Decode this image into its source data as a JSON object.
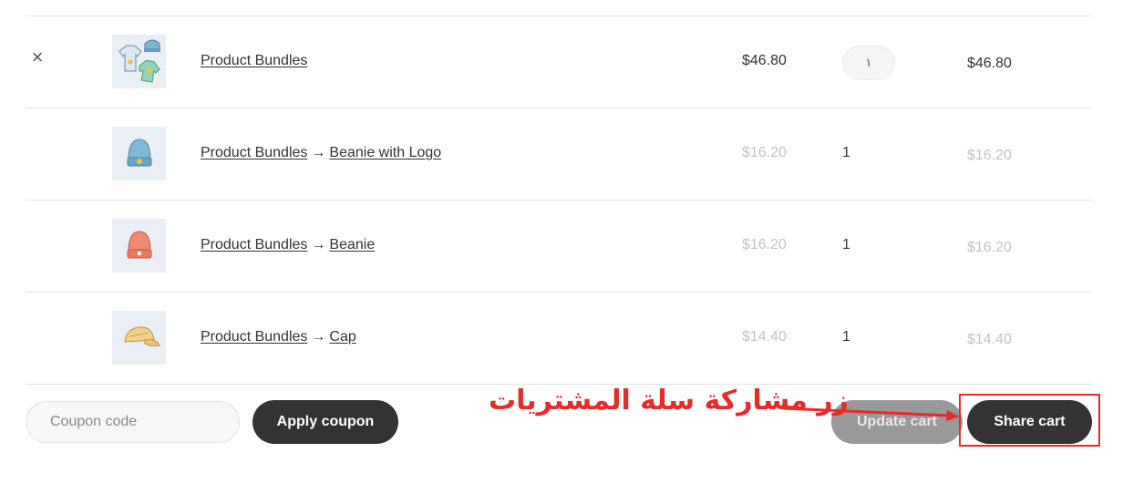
{
  "cart": {
    "items": [
      {
        "remove_icon": "×",
        "parent": "Product Bundles",
        "child": "",
        "price": "$46.80",
        "qty": "١",
        "subtotal": "$46.80",
        "thumb": "bundle-apparel-icon"
      },
      {
        "parent": "Product Bundles",
        "arrow": "→",
        "child": "Beanie with Logo",
        "price": "$16.20",
        "qty": "1",
        "subtotal": "$16.20",
        "thumb": "blue-beanie-icon"
      },
      {
        "parent": "Product Bundles",
        "arrow": "→",
        "child": "Beanie",
        "price": "$16.20",
        "qty": "1",
        "subtotal": "$16.20",
        "thumb": "orange-beanie-icon"
      },
      {
        "parent": "Product Bundles",
        "arrow": "→",
        "child": "Cap",
        "price": "$14.40",
        "qty": "1",
        "subtotal": "$14.40",
        "thumb": "yellow-cap-icon"
      }
    ]
  },
  "actions": {
    "coupon_placeholder": "Coupon code",
    "apply_label": "Apply coupon",
    "update_label": "Update cart",
    "share_label": "Share cart"
  },
  "annotation": {
    "text": "زر مشاركة سلة المشتريات",
    "color": "#e52b2b"
  }
}
